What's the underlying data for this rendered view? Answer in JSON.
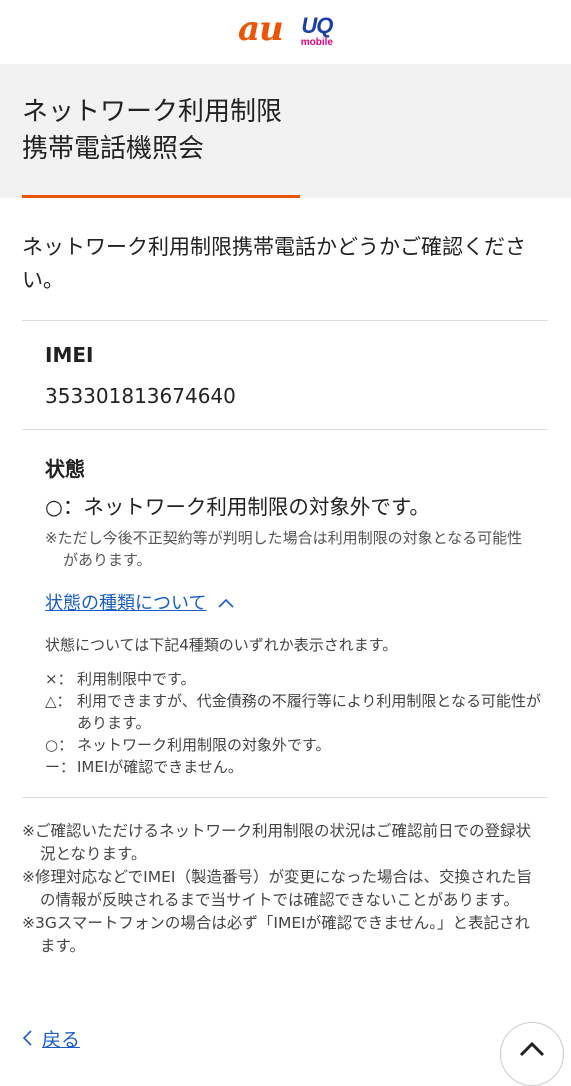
{
  "header": {
    "brand_au": "au",
    "brand_uq": "UQ",
    "brand_uq_sub": "mobile"
  },
  "page": {
    "title_line1": "ネットワーク利用制限",
    "title_line2": "携帯電話機照会",
    "lead": "ネットワーク利用制限携帯電話かどうかご確認ください。"
  },
  "imei": {
    "label": "IMEI",
    "value": "353301813674640"
  },
  "status": {
    "label": "状態",
    "result": "○：ネットワーク利用制限の対象外です。",
    "note": "※ただし今後不正契約等が判明した場合は利用制限の対象となる可能性があります。",
    "types_link": "状態の種類について",
    "types_intro": "状態については下記4種類のいずれか表示されます。",
    "legend": [
      {
        "symbol": "×：",
        "text": "利用制限中です。"
      },
      {
        "symbol": "△：",
        "text": "利用できますが、代金債務の不履行等により利用制限となる可能性があります。"
      },
      {
        "symbol": "○：",
        "text": "ネットワーク利用制限の対象外です。"
      },
      {
        "symbol": "ー：",
        "text": "IMEIが確認できません。"
      }
    ]
  },
  "notes": [
    "※ご確認いただけるネットワーク利用制限の状況はご確認前日での登録状況となります。",
    "※修理対応などでIMEI（製造番号）が変更になった場合は、交換された旨の情報が反映されるまで当サイトでは確認できないことがあります。",
    "※3Gスマートフォンの場合は必ず「IMEIが確認できません。」と表記されます。"
  ],
  "footer": {
    "back_label": "戻る"
  },
  "colors": {
    "accent": "#eb5505",
    "link": "#1a5cc8",
    "band": "#f2f2f2"
  }
}
